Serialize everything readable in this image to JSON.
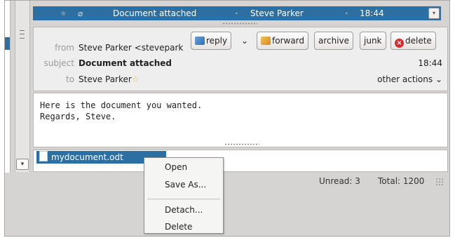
{
  "message_list": {
    "selected_row": {
      "subject": "Document attached",
      "sender": "Steve Parker",
      "time": "18:44",
      "star_icon": "star-icon",
      "attachment_icon": "paperclip-icon",
      "dot": "•"
    }
  },
  "header": {
    "from_label": "from",
    "from_value": "Steve Parker <stevepark",
    "subject_label": "subject",
    "subject_value": "Document attached",
    "to_label": "to",
    "to_value": "Steve Parker",
    "time": "18:44",
    "other_actions": "other actions"
  },
  "toolbar": {
    "reply": "reply",
    "forward": "forward",
    "archive": "archive",
    "junk": "junk",
    "delete": "delete"
  },
  "body": {
    "lines": [
      "Here is the document you wanted.",
      "Regards, Steve."
    ]
  },
  "attachment": {
    "filename": "mydocument.odt"
  },
  "context_menu": {
    "open": "Open",
    "save_as": "Save As...",
    "detach": "Detach...",
    "delete": "Delete"
  },
  "status": {
    "unread": "Unread: 3",
    "total": "Total: 1200"
  },
  "colors": {
    "selection": "#2c6fa2",
    "delete_red": "#d8292e",
    "star_yellow": "#f0c020"
  }
}
